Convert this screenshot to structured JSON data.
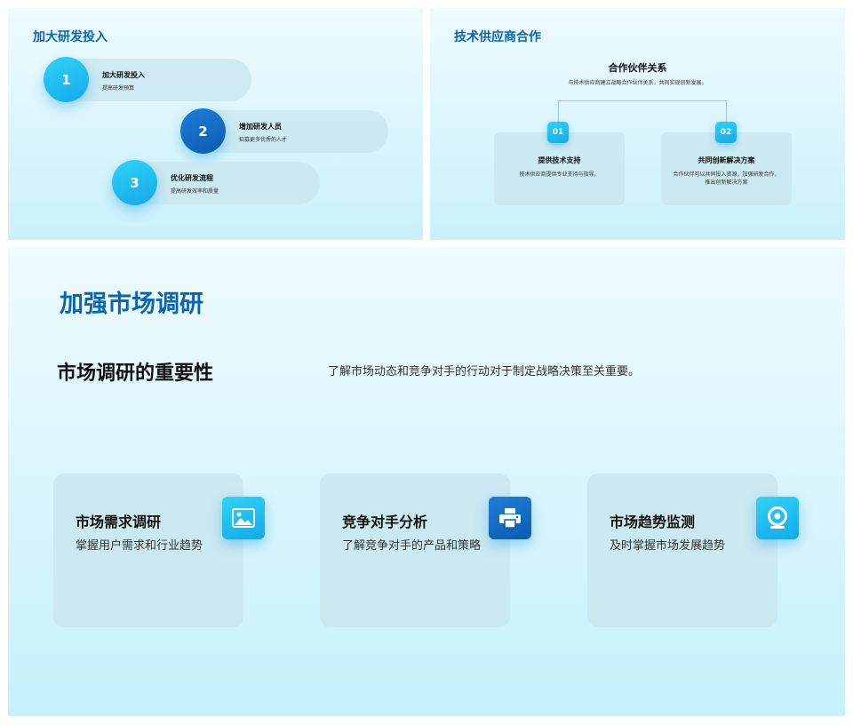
{
  "slide1": {
    "title": "加大研发投入",
    "steps": [
      {
        "num": "1",
        "title": "加大研发投入",
        "desc": "提高研发预算"
      },
      {
        "num": "2",
        "title": "增加研发人员",
        "desc": "招募更多优秀的人才"
      },
      {
        "num": "3",
        "title": "优化研发流程",
        "desc": "提高研发效率和质量"
      }
    ]
  },
  "slide2": {
    "title": "技术供应商合作",
    "center_title": "合作伙伴关系",
    "center_subtitle": "与技术供应商建立战略合作伙伴关系，共同实现创新发展。",
    "cards": [
      {
        "badge": "01",
        "title": "提供技术支持",
        "desc": "技术供应商提供专业支持与指导。"
      },
      {
        "badge": "02",
        "title": "共同创新解决方案",
        "desc": "合作伙伴可以共同投入资源，加强研发合作，推出创新解决方案"
      }
    ]
  },
  "slide3": {
    "title": "加强市场调研",
    "subtitle": "市场调研的重要性",
    "intro": "了解市场动态和竞争对手的行动对于制定战略决策至关重要。",
    "cards": [
      {
        "title": "市场需求调研",
        "desc": "掌握用户需求和行业趋势",
        "icon": "image-icon"
      },
      {
        "title": "竞争对手分析",
        "desc": "了解竞争对手的产品和策略",
        "icon": "printer-icon"
      },
      {
        "title": "市场趋势监测",
        "desc": "及时掌握市场发展趋势",
        "icon": "webcam-icon"
      }
    ]
  },
  "colors": {
    "accent_title": "#0a64b4",
    "accent_light": "#1fb8f0",
    "accent_dark": "#0b5bb0"
  }
}
